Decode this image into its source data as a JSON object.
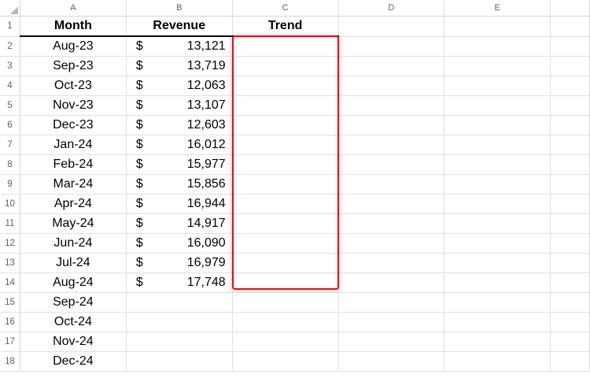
{
  "columns": [
    "A",
    "B",
    "C",
    "D",
    "E"
  ],
  "headers": {
    "month": "Month",
    "revenue": "Revenue",
    "trend": "Trend"
  },
  "currency_symbol": "$",
  "rows": [
    {
      "num": "1"
    },
    {
      "num": "2",
      "month": "Aug-23",
      "revenue": "13,121"
    },
    {
      "num": "3",
      "month": "Sep-23",
      "revenue": "13,719"
    },
    {
      "num": "4",
      "month": "Oct-23",
      "revenue": "12,063"
    },
    {
      "num": "5",
      "month": "Nov-23",
      "revenue": "13,107"
    },
    {
      "num": "6",
      "month": "Dec-23",
      "revenue": "12,603"
    },
    {
      "num": "7",
      "month": "Jan-24",
      "revenue": "16,012"
    },
    {
      "num": "8",
      "month": "Feb-24",
      "revenue": "15,977"
    },
    {
      "num": "9",
      "month": "Mar-24",
      "revenue": "15,856"
    },
    {
      "num": "10",
      "month": "Apr-24",
      "revenue": "16,944"
    },
    {
      "num": "11",
      "month": "May-24",
      "revenue": "14,917"
    },
    {
      "num": "12",
      "month": "Jun-24",
      "revenue": "16,090"
    },
    {
      "num": "13",
      "month": "Jul-24",
      "revenue": "16,979"
    },
    {
      "num": "14",
      "month": "Aug-24",
      "revenue": "17,748"
    },
    {
      "num": "15",
      "month": "Sep-24"
    },
    {
      "num": "16",
      "month": "Oct-24"
    },
    {
      "num": "17",
      "month": "Nov-24"
    },
    {
      "num": "18",
      "month": "Dec-24"
    }
  ],
  "selection_color": "#d8141b"
}
